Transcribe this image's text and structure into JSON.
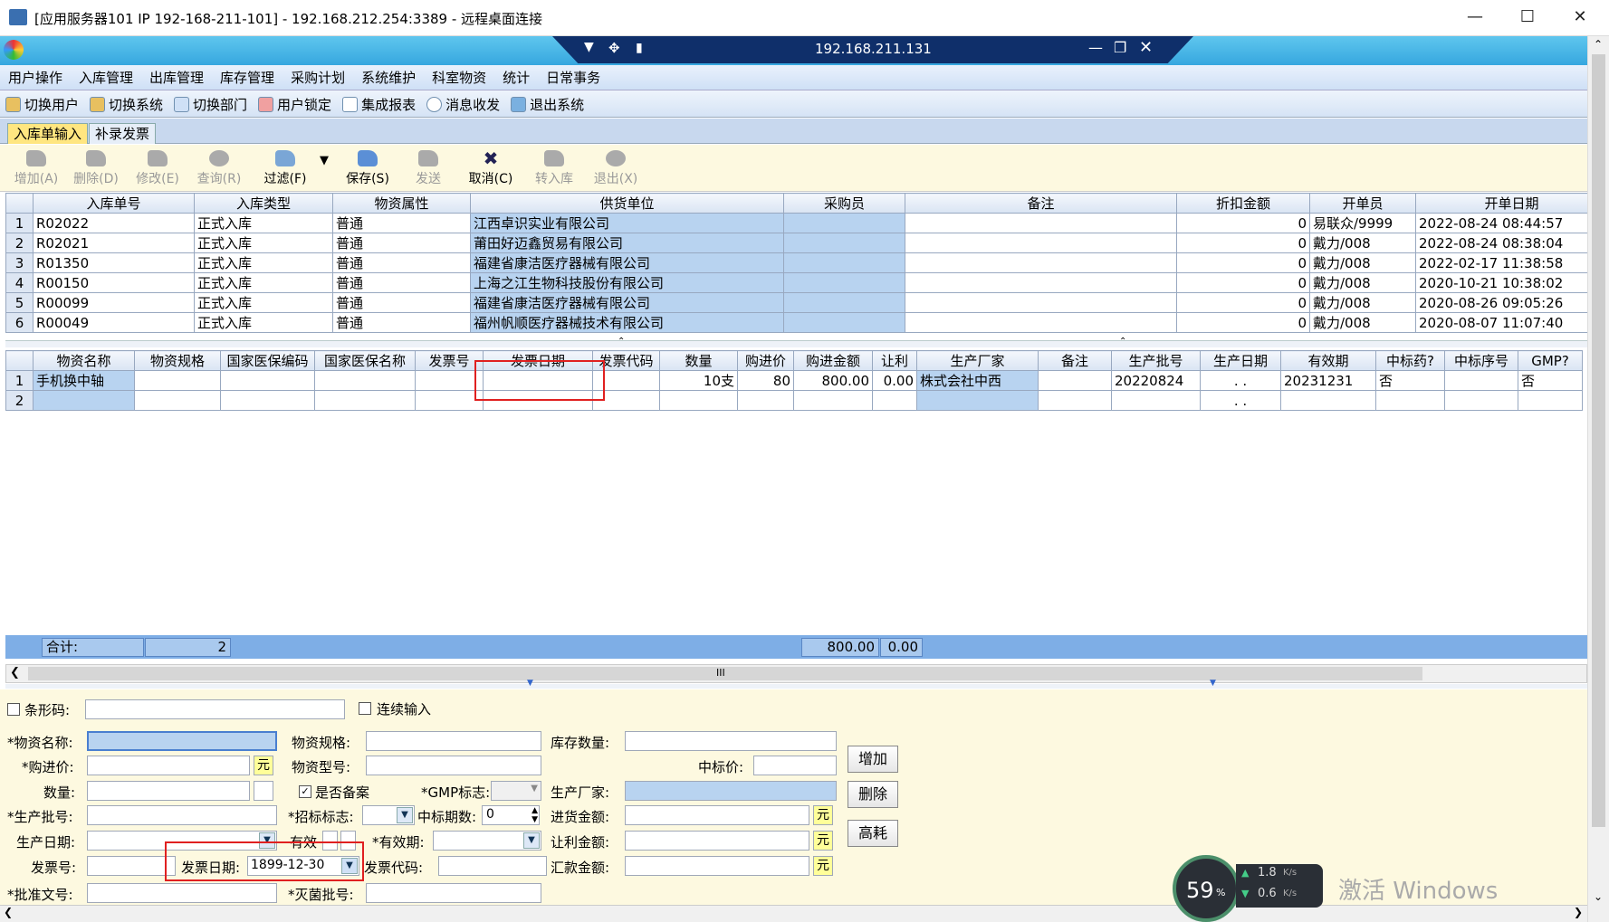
{
  "window": {
    "title": "[应用服务器101  IP 192-168-211-101] - 192.168.212.254:3389 - 远程桌面连接",
    "min_icon": "minimize-icon",
    "max_icon": "maximize-icon",
    "close_icon": "close-icon"
  },
  "rdp": {
    "ip": "192.168.211.131"
  },
  "menu": [
    "用户操作",
    "入库管理",
    "出库管理",
    "库存管理",
    "采购计划",
    "系统维护",
    "科室物资",
    "统计",
    "日常事务"
  ],
  "toolbar": [
    "切换用户",
    "切换系统",
    "切换部门",
    "用户锁定",
    "集成报表",
    "消息收发",
    "退出系统"
  ],
  "tabs": [
    "入库单输入",
    "补录发票"
  ],
  "actions": [
    {
      "label": "增加(A)",
      "enabled": false
    },
    {
      "label": "删除(D)",
      "enabled": false
    },
    {
      "label": "修改(E)",
      "enabled": false
    },
    {
      "label": "查询(R)",
      "enabled": false
    },
    {
      "label": "过滤(F)",
      "enabled": true
    },
    {
      "label": "保存(S)",
      "enabled": true
    },
    {
      "label": "发送",
      "enabled": false
    },
    {
      "label": "取消(C)",
      "enabled": true
    },
    {
      "label": "转入库",
      "enabled": false
    },
    {
      "label": "退出(X)",
      "enabled": false
    }
  ],
  "master": {
    "headers": [
      "入库单号",
      "入库类型",
      "物资属性",
      "供货单位",
      "采购员",
      "备注",
      "折扣金额",
      "开单员",
      "开单日期"
    ],
    "rows": [
      [
        "1",
        "R02022",
        "正式入库",
        "普通",
        "江西卓识实业有限公司",
        "",
        "",
        "0",
        "易联众/9999",
        "2022-08-24 08:44:57"
      ],
      [
        "2",
        "R02021",
        "正式入库",
        "普通",
        "莆田好迈鑫贸易有限公司",
        "",
        "",
        "0",
        "戴力/008",
        "2022-08-24 08:38:04"
      ],
      [
        "3",
        "R01350",
        "正式入库",
        "普通",
        "福建省康洁医疗器械有限公司",
        "",
        "",
        "0",
        "戴力/008",
        "2022-02-17 11:38:58"
      ],
      [
        "4",
        "R00150",
        "正式入库",
        "普通",
        "上海之江生物科技股份有限公司",
        "",
        "",
        "0",
        "戴力/008",
        "2020-10-21 10:38:02"
      ],
      [
        "5",
        "R00099",
        "正式入库",
        "普通",
        "福建省康洁医疗器械有限公司",
        "",
        "",
        "0",
        "戴力/008",
        "2020-08-26 09:05:26"
      ],
      [
        "6",
        "R00049",
        "正式入库",
        "普通",
        "福州帆顺医疗器械技术有限公司",
        "",
        "",
        "0",
        "戴力/008",
        "2020-08-07 11:07:40"
      ]
    ]
  },
  "detail": {
    "headers": [
      "物资名称",
      "物资规格",
      "国家医保编码",
      "国家医保名称",
      "发票号",
      "发票日期",
      "发票代码",
      "数量",
      "购进价",
      "购进金额",
      "让利",
      "生产厂家",
      "备注",
      "生产批号",
      "生产日期",
      "有效期",
      "中标药?",
      "中标序号",
      "GMP?"
    ],
    "rows": [
      [
        "1",
        "手机换中轴",
        "",
        "",
        "",
        "",
        "",
        "",
        "10支",
        "80",
        "800.00",
        "0.00",
        "株式会社中西",
        "",
        "20220824",
        ".  .",
        "20231231",
        "否",
        "",
        "否"
      ],
      [
        "2",
        "",
        "",
        "",
        "",
        "",
        "",
        "",
        "",
        "",
        "",
        "",
        "",
        "",
        "",
        ".  .",
        "",
        "",
        "",
        ""
      ]
    ]
  },
  "summary": {
    "label": "合计:",
    "count": "2",
    "amount": "800.00",
    "discount": "0.00"
  },
  "scroll_grip": "III",
  "form": {
    "barcode": "条形码:",
    "continuous": "连续输入",
    "name": "*物资名称:",
    "spec": "物资规格:",
    "stock": "库存数量:",
    "price": "*购进价:",
    "model": "物资型号:",
    "bid_price": "中标价:",
    "qty": "数量:",
    "filed": "是否备案",
    "gmp": "*GMP标志:",
    "maker": "生产厂家:",
    "batch": "*生产批号:",
    "tender": "*招标标志:",
    "bid_period": "中标期数:",
    "bid_period_value": "0",
    "in_amount": "进货金额:",
    "prod_date": "生产日期:",
    "valid": "有效",
    "expiry": "*有效期:",
    "discount_amount": "让利金额:",
    "invoice_no": "发票号:",
    "invoice_date": "发票日期:",
    "invoice_date_value": "1899-12-30",
    "invoice_code": "发票代码:",
    "remit": "汇款金额:",
    "approval": "*批准文号:",
    "steril": "*灭菌批号:",
    "yuan": "元",
    "buttons": [
      "增加",
      "删除",
      "高耗"
    ]
  },
  "net": {
    "percent": "59",
    "pct_sign": "%",
    "up": "1.8",
    "down": "0.6",
    "unit": "K/s"
  },
  "watermark": "激活 Windows"
}
